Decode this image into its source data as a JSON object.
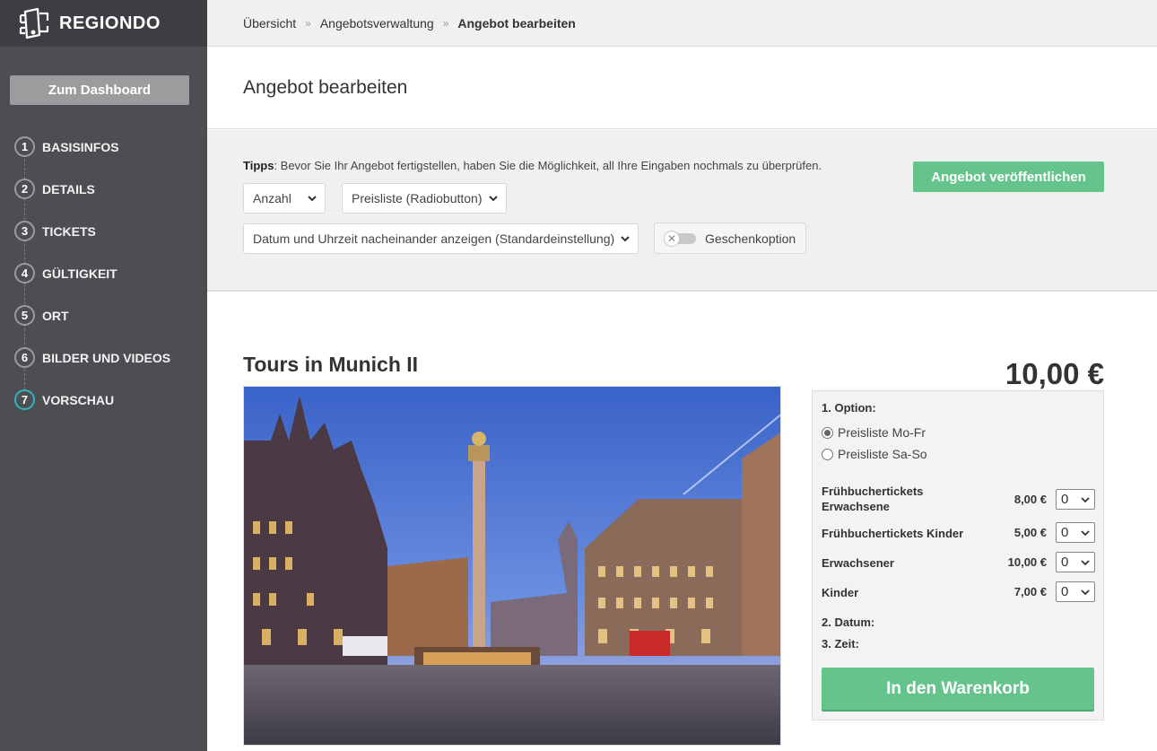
{
  "brand": {
    "name": "REGIONDO"
  },
  "sidebar": {
    "dashboard_label": "Zum Dashboard",
    "steps": [
      {
        "num": "1",
        "label": "BASISINFOS"
      },
      {
        "num": "2",
        "label": "DETAILS"
      },
      {
        "num": "3",
        "label": "TICKETS"
      },
      {
        "num": "4",
        "label": "GÜLTIGKEIT"
      },
      {
        "num": "5",
        "label": "ORT"
      },
      {
        "num": "6",
        "label": "BILDER UND VIDEOS"
      },
      {
        "num": "7",
        "label": "VORSCHAU"
      }
    ],
    "active_step": "7"
  },
  "breadcrumb": {
    "items": [
      "Übersicht",
      "Angebotsverwaltung",
      "Angebot bearbeiten"
    ],
    "separator": "»"
  },
  "page": {
    "title": "Angebot bearbeiten"
  },
  "tips": {
    "label": "Tipps",
    "text": ": Bevor Sie Ihr Angebot fertigstellen, haben Sie die Möglichkeit, all Ihre Eingaben nochmals zu überprüfen.",
    "select_quantity": "Anzahl",
    "select_pricelist": "Preisliste (Radiobutton)",
    "select_datetime": "Datum und Uhrzeit nacheinander anzeigen (Standardeinstellung)",
    "gift_option": "Geschenkoption",
    "publish_label": "Angebot veröffentlichen"
  },
  "preview": {
    "tour_title": "Tours in Munich II",
    "price": "10,00 €",
    "option_label": "1. Option:",
    "price_lists": [
      {
        "label": "Preisliste Mo-Fr",
        "checked": true
      },
      {
        "label": "Preisliste Sa-So",
        "checked": false
      }
    ],
    "tickets": [
      {
        "name": "Frühbuchertickets Erwachsene",
        "price": "8,00 €",
        "qty": "0"
      },
      {
        "name": "Frühbuchertickets Kinder",
        "price": "5,00 €",
        "qty": "0"
      },
      {
        "name": "Erwachsener",
        "price": "10,00 €",
        "qty": "0"
      },
      {
        "name": "Kinder",
        "price": "7,00 €",
        "qty": "0"
      }
    ],
    "date_label": "2. Datum:",
    "time_label": "3. Zeit:",
    "cart_label": "In den Warenkorb"
  },
  "colors": {
    "sidebar_bg": "#4d4e52",
    "accent_green": "#64c48b",
    "active_step_ring": "#2fb3c1"
  }
}
